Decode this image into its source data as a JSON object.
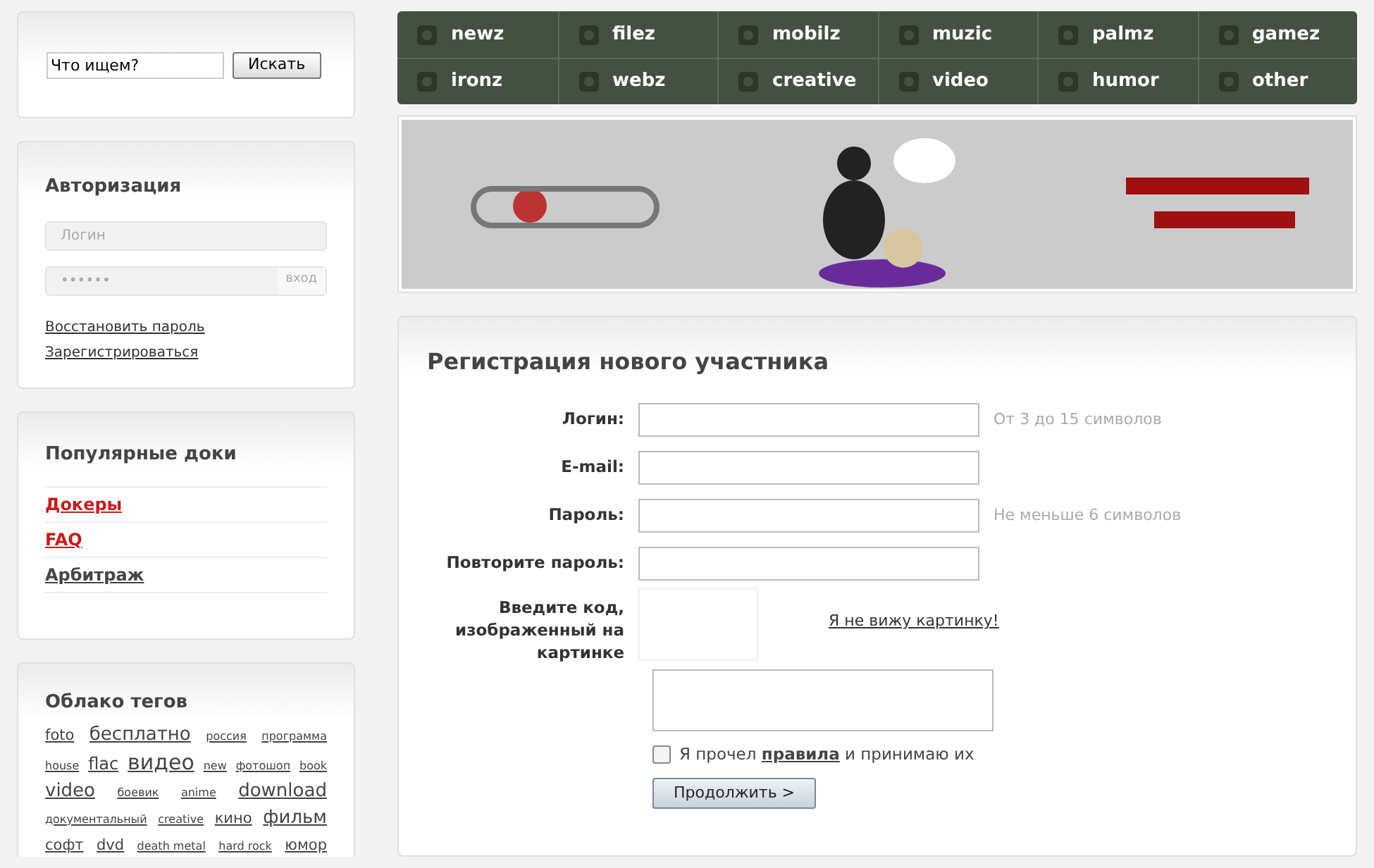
{
  "search": {
    "value": "Что ищем?",
    "button": "Искать"
  },
  "auth": {
    "title": "Авторизация",
    "login_placeholder": "Логин",
    "password_placeholder": "••••••",
    "enter": "вход",
    "links": [
      "Восстановить пароль",
      "Зарегистрироваться"
    ]
  },
  "popular": {
    "title": "Популярные доки",
    "items": [
      {
        "label": "Докеры",
        "highlighted": true
      },
      {
        "label": "FAQ",
        "highlighted": true
      },
      {
        "label": "Арбитраж",
        "highlighted": false
      }
    ]
  },
  "tags": {
    "title": "Облако тегов",
    "items": [
      {
        "label": "foto",
        "kind": "sm"
      },
      {
        "label": "бесплатно",
        "kind": "lg"
      },
      {
        "label": "россия",
        "kind": "xs"
      },
      {
        "label": "программа",
        "kind": "xs"
      },
      {
        "label": "house",
        "kind": "xs"
      },
      {
        "label": "flac",
        "kind": "md"
      },
      {
        "label": "видео",
        "kind": "xl"
      },
      {
        "label": "new",
        "kind": "xs"
      },
      {
        "label": "фотошоп",
        "kind": "xs"
      },
      {
        "label": "book",
        "kind": "xs"
      },
      {
        "label": "video",
        "kind": "lg"
      },
      {
        "label": "боевик",
        "kind": "xs"
      },
      {
        "label": "anime",
        "kind": "xs"
      },
      {
        "label": "download",
        "kind": "lg"
      },
      {
        "label": "документальный",
        "kind": "xs"
      },
      {
        "label": "creative",
        "kind": "xs"
      },
      {
        "label": "кино",
        "kind": "sm"
      },
      {
        "label": "фильм",
        "kind": "lg"
      },
      {
        "label": "софт",
        "kind": "sm"
      },
      {
        "label": "dvd",
        "kind": "sm"
      },
      {
        "label": "death metal",
        "kind": "xs"
      },
      {
        "label": "hard rock",
        "kind": "xs"
      },
      {
        "label": "юмор",
        "kind": "sm"
      }
    ]
  },
  "nav": [
    {
      "label": "newz"
    },
    {
      "label": "filez"
    },
    {
      "label": "mobilz"
    },
    {
      "label": "muzic"
    },
    {
      "label": "palmz"
    },
    {
      "label": "gamez"
    },
    {
      "label": "ironz"
    },
    {
      "label": "webz"
    },
    {
      "label": "creative"
    },
    {
      "label": "video"
    },
    {
      "label": "humor"
    },
    {
      "label": "other"
    }
  ],
  "form": {
    "title": "Регистрация нового участника",
    "fields": [
      {
        "label": "Логин:",
        "hint": "От 3 до 15 символов"
      },
      {
        "label": "E-mail:"
      },
      {
        "label": "Пароль:",
        "hint": "Не меньше 6 символов"
      },
      {
        "label": "Повторите пароль:"
      }
    ],
    "captcha_label": "Введите код, изображенный на картинке",
    "captcha_link": "Я не вижу картинку!",
    "agree": {
      "checked": false,
      "text": "Я прочел **правила** и принимаю их"
    },
    "submit": "Продолжить >"
  }
}
